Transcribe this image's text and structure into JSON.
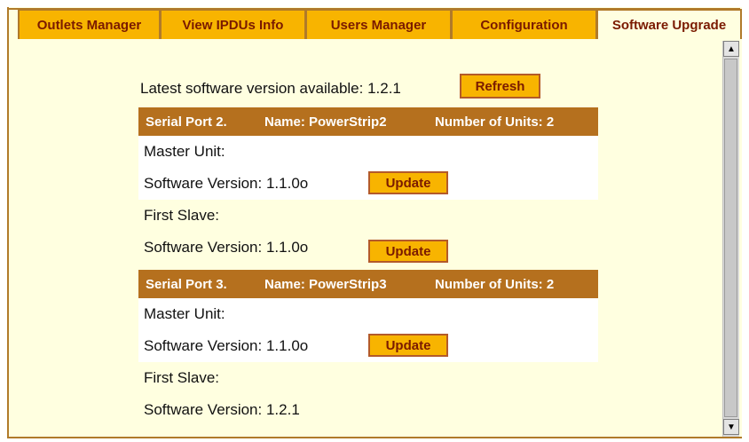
{
  "tabs": [
    {
      "label": "Outlets Manager",
      "active": false
    },
    {
      "label": "View IPDUs Info",
      "active": false
    },
    {
      "label": "Users Manager",
      "active": false
    },
    {
      "label": "Configuration",
      "active": false
    },
    {
      "label": "Software Upgrade",
      "active": true
    }
  ],
  "latest_version_text": "Latest software version available: 1.2.1",
  "refresh_label": "Refresh",
  "panels": [
    {
      "serial_port": "Serial Port 2.",
      "name": "Name: PowerStrip2",
      "units": "Number of Units: 2",
      "master_label": "Master Unit:",
      "master_version": "Software Version:  1.1.0o",
      "master_update": "Update",
      "slave_label": "First Slave:",
      "slave_version": "Software Version: 1.1.0o",
      "slave_update": "Update"
    },
    {
      "serial_port": "Serial Port 3.",
      "name": "Name: PowerStrip3",
      "units": "Number of Units: 2",
      "master_label": "Master Unit:",
      "master_version": "Software Version:  1.1.0o",
      "master_update": "Update",
      "slave_label": "First Slave:",
      "slave_version": "Software Version: 1.2.1"
    }
  ],
  "colors": {
    "tab_bg": "#f8b400",
    "tab_text": "#7a1a00",
    "header_bg": "#b5701e",
    "page_bg": "#ffffe0"
  },
  "icons": {
    "scroll_up": "scroll-up-arrow-icon",
    "scroll_down": "scroll-down-arrow-icon"
  }
}
